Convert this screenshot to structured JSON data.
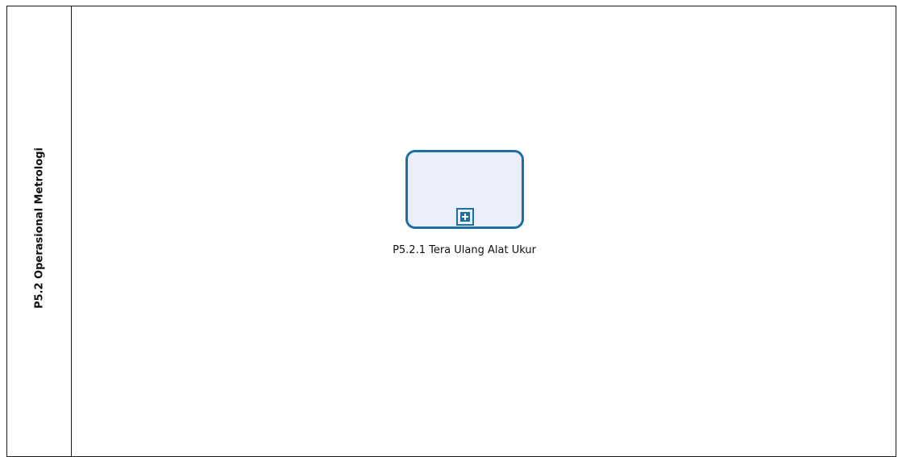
{
  "pool": {
    "label": "P5.2 Operasional Metrologi"
  },
  "task": {
    "label": "P5.2.1 Tera Ulang Alat Ukur",
    "marker_icon": "plus-square-icon",
    "stroke_color": "#1e6fa3",
    "fill_color": "#ebeffc"
  }
}
